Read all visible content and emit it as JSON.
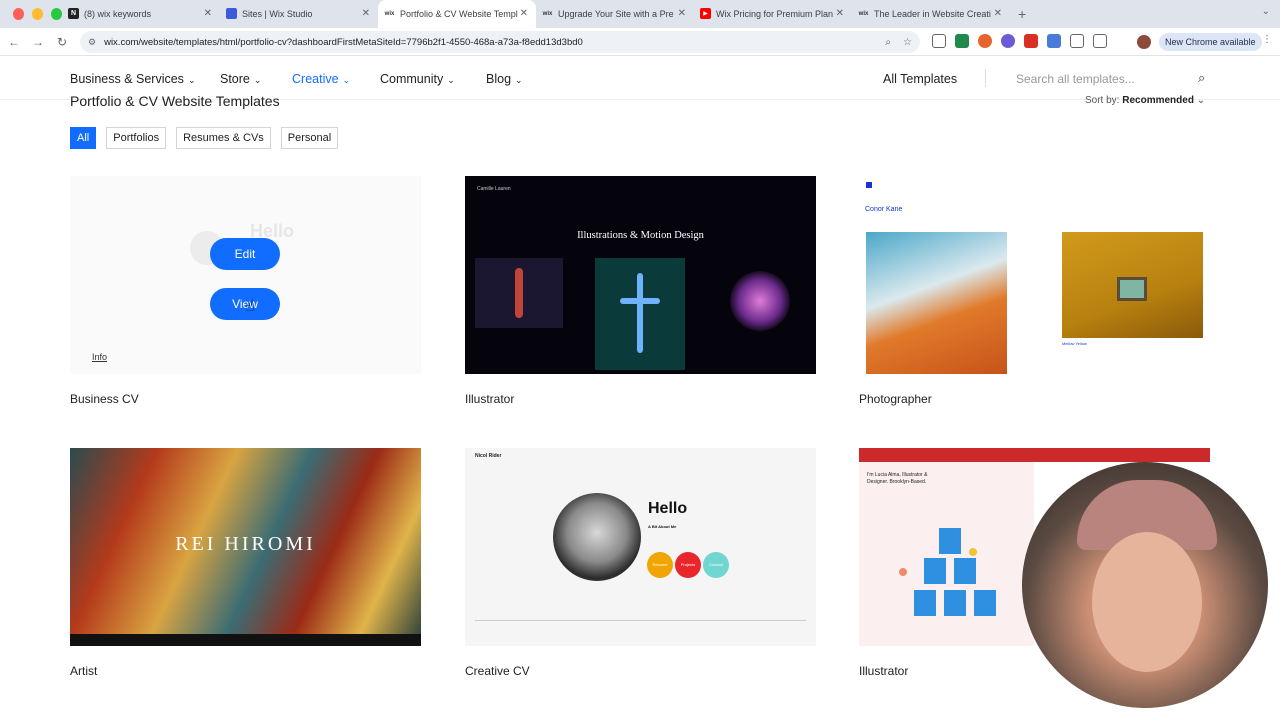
{
  "browser": {
    "tabs": [
      {
        "title": "(8) wix keywords",
        "fav": "N",
        "favcolor": "#222222",
        "active": false
      },
      {
        "title": "Sites | Wix Studio",
        "fav": "",
        "favcolor": "#3b5bdb",
        "active": false
      },
      {
        "title": "Portfolio & CV Website Templ",
        "fav": "wix",
        "favcolor": "#444444",
        "active": true
      },
      {
        "title": "Upgrade Your Site with a Pre",
        "fav": "wix",
        "favcolor": "#444444",
        "active": false
      },
      {
        "title": "Wix Pricing for Premium Plan",
        "fav": "▶",
        "favcolor": "#ff0000",
        "active": false
      },
      {
        "title": "The Leader in Website Creati",
        "fav": "wix",
        "favcolor": "#444444",
        "active": false
      }
    ],
    "url": "wix.com/website/templates/html/portfolio-cv?dashboardFirstMetaSiteId=7796b2f1-4550-468a-a73a-f8edd13d3bd0",
    "new_chrome": "New Chrome available"
  },
  "nav": {
    "items": [
      {
        "label": "Business & Services"
      },
      {
        "label": "Store"
      },
      {
        "label": "Creative"
      },
      {
        "label": "Community"
      },
      {
        "label": "Blog"
      }
    ],
    "all_templates": "All Templates",
    "search_placeholder": "Search all templates..."
  },
  "page": {
    "title": "Portfolio & CV Website Templates",
    "sort_label": "Sort by:",
    "sort_value": "Recommended"
  },
  "filters": [
    "All",
    "Portfolios",
    "Resumes & CVs",
    "Personal"
  ],
  "cards": [
    {
      "label": "Business CV",
      "edit": "Edit",
      "view": "View",
      "info": "Info"
    },
    {
      "label": "Illustrator",
      "preview_title": "Illustrations & Motion Design",
      "preview_brand": "Camille Lauren"
    },
    {
      "label": "Photographer",
      "preview_name": "Conor Kane",
      "preview_caption": "Mellow Yellow"
    },
    {
      "label": "Artist",
      "preview_name": "REI HIROMI"
    },
    {
      "label": "Creative CV",
      "preview_hello": "Hello",
      "preview_sub": "A Bit About Me",
      "preview_brand": "Nicol Rider",
      "preview_btns": [
        "Resume",
        "Projects",
        "Contact"
      ]
    },
    {
      "label": "Illustrator",
      "preview_intro": "I'm Lucia Alma, Illustrator & Designer. Brooklyn-Based."
    }
  ]
}
